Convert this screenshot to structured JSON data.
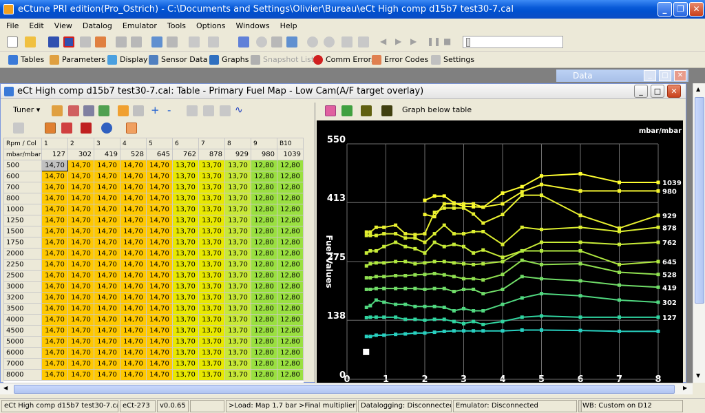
{
  "window": {
    "title": "eCtune PRI edition(Pro_Ostrich) - C:\\Documents and Settings\\Olivier\\Bureau\\eCt High comp d15b7 test30-7.cal"
  },
  "menu": [
    "File",
    "Edit",
    "View",
    "Datalog",
    "Emulator",
    "Tools",
    "Options",
    "Windows",
    "Help"
  ],
  "toolbar2": [
    {
      "label": "Tables",
      "icon": "table-icon",
      "enabled": true
    },
    {
      "label": "Parameters",
      "icon": "parameters-icon",
      "enabled": true
    },
    {
      "label": "Display",
      "icon": "display-icon",
      "enabled": true
    },
    {
      "label": "Sensor Data",
      "icon": "sensor-data-icon",
      "enabled": true
    },
    {
      "label": "Graphs",
      "icon": "graphs-icon",
      "enabled": true
    },
    {
      "label": "Snapshot List",
      "icon": "snapshot-icon",
      "enabled": false
    },
    {
      "label": "Comm Errors",
      "icon": "comm-errors-icon",
      "enabled": true
    },
    {
      "label": "Error Codes",
      "icon": "error-codes-icon",
      "enabled": true
    },
    {
      "label": "Settings",
      "icon": "settings-icon",
      "enabled": true
    }
  ],
  "data_window": {
    "title": "Data"
  },
  "mdi": {
    "title": "eCt High comp d15b7 test30-7.cal: Table - Primary Fuel Map - Low Cam(A/F target overlay)",
    "tuner_label": "Tuner",
    "graph_below_label": "Graph below table"
  },
  "table": {
    "corner_top": "Rpm / Col",
    "corner_bottom": "mbar/mbar",
    "col_index": [
      "1",
      "2",
      "3",
      "4",
      "5",
      "6",
      "7",
      "8",
      "9",
      "B10"
    ],
    "col_mbar": [
      "127",
      "302",
      "419",
      "528",
      "645",
      "762",
      "878",
      "929",
      "980",
      "1039"
    ],
    "rpm": [
      "500",
      "600",
      "700",
      "800",
      "1000",
      "1250",
      "1500",
      "1750",
      "2000",
      "2250",
      "2500",
      "3000",
      "3200",
      "3500",
      "4000",
      "4500",
      "5000",
      "6000",
      "7000",
      "8000"
    ],
    "row_values": [
      "14,70",
      "14,70",
      "14,70",
      "14,70",
      "14,70",
      "13,70",
      "13,70",
      "13,70",
      "12,80",
      "12,80"
    ],
    "colors": {
      "yellow": "#ffc800",
      "lime": "#e8e800",
      "yellowgreen": "#c8e838",
      "green": "#9ae040",
      "selected": "#c0c0c0"
    }
  },
  "chart_data": {
    "type": "line",
    "ylabel": "Fuel Values",
    "unit_label": "mbar/mbar",
    "ylim": [
      0,
      550
    ],
    "xlim": [
      0,
      8
    ],
    "yticks": [
      "0",
      "138",
      "275",
      "413",
      "550"
    ],
    "xticks": [
      "0",
      "1",
      "2",
      "3",
      "4",
      "5",
      "6",
      "7",
      "8"
    ],
    "x": [
      0.5,
      0.6,
      0.75,
      0.95,
      1.25,
      1.5,
      1.75,
      2.0,
      2.25,
      2.5,
      2.75,
      3.0,
      3.25,
      3.5,
      4.0,
      4.5,
      5.0,
      6.0,
      7.0,
      8.0
    ],
    "series": [
      {
        "name": "1039",
        "color": "#ffff30",
        "values": [
          null,
          null,
          null,
          null,
          null,
          null,
          null,
          418,
          428,
          428,
          412,
          404,
          403,
          402,
          435,
          450,
          475,
          480,
          460,
          460
        ]
      },
      {
        "name": "980",
        "color": "#f4f430",
        "values": [
          null,
          null,
          null,
          null,
          null,
          null,
          null,
          385,
          380,
          410,
          410,
          410,
          410,
          402,
          410,
          438,
          455,
          440,
          440,
          440
        ]
      },
      {
        "name": "929",
        "color": "#e8f030",
        "values": [
          344,
          344,
          355,
          355,
          360,
          340,
          338,
          340,
          390,
          400,
          400,
          400,
          386,
          365,
          385,
          430,
          430,
          383,
          353,
          383
        ]
      },
      {
        "name": "878",
        "color": "#dcee30",
        "values": [
          336,
          336,
          336,
          340,
          340,
          330,
          330,
          320,
          340,
          360,
          340,
          340,
          345,
          345,
          315,
          355,
          350,
          355,
          345,
          355
        ]
      },
      {
        "name": "762",
        "color": "#c8ec38",
        "values": [
          295,
          300,
          300,
          310,
          320,
          310,
          305,
          295,
          320,
          310,
          315,
          310,
          295,
          302,
          285,
          300,
          320,
          320,
          315,
          320
        ]
      },
      {
        "name": "645",
        "color": "#b0e840",
        "values": [
          265,
          270,
          272,
          272,
          275,
          275,
          270,
          272,
          275,
          275,
          272,
          270,
          268,
          270,
          275,
          300,
          300,
          300,
          268,
          275
        ]
      },
      {
        "name": "528",
        "color": "#90e050",
        "values": [
          237,
          237,
          240,
          240,
          242,
          242,
          244,
          245,
          247,
          244,
          240,
          235,
          235,
          232,
          245,
          278,
          268,
          270,
          250,
          245
        ]
      },
      {
        "name": "419",
        "color": "#70dc68",
        "values": [
          210,
          210,
          212,
          212,
          212,
          212,
          212,
          210,
          212,
          212,
          205,
          210,
          210,
          200,
          210,
          240,
          235,
          230,
          220,
          215
        ]
      },
      {
        "name": "302",
        "color": "#50d880",
        "values": [
          168,
          172,
          185,
          180,
          175,
          175,
          170,
          170,
          170,
          168,
          160,
          165,
          160,
          160,
          175,
          190,
          200,
          195,
          185,
          180
        ]
      },
      {
        "name": "127",
        "color": "#30d4a0",
        "values": [
          144,
          145,
          145,
          145,
          145,
          140,
          140,
          138,
          140,
          140,
          135,
          130,
          135,
          128,
          135,
          145,
          148,
          145,
          145,
          145
        ]
      },
      {
        "name": "",
        "color": "#28d0c0",
        "values": [
          100,
          100,
          103,
          103,
          105,
          106,
          108,
          108,
          110,
          112,
          113,
          113,
          113,
          113,
          113,
          115,
          115,
          114,
          112,
          112
        ]
      }
    ]
  },
  "status": [
    "eCt High comp d15b7 test30-7.cal",
    "eCt-273",
    "v0.0.65",
    "",
    ">Load: Map 1,7 bar  >Final multiplier 1",
    "Datalogging: Disconnected",
    "Emulator: Disconnected",
    "",
    "WB: Custom on D12"
  ]
}
